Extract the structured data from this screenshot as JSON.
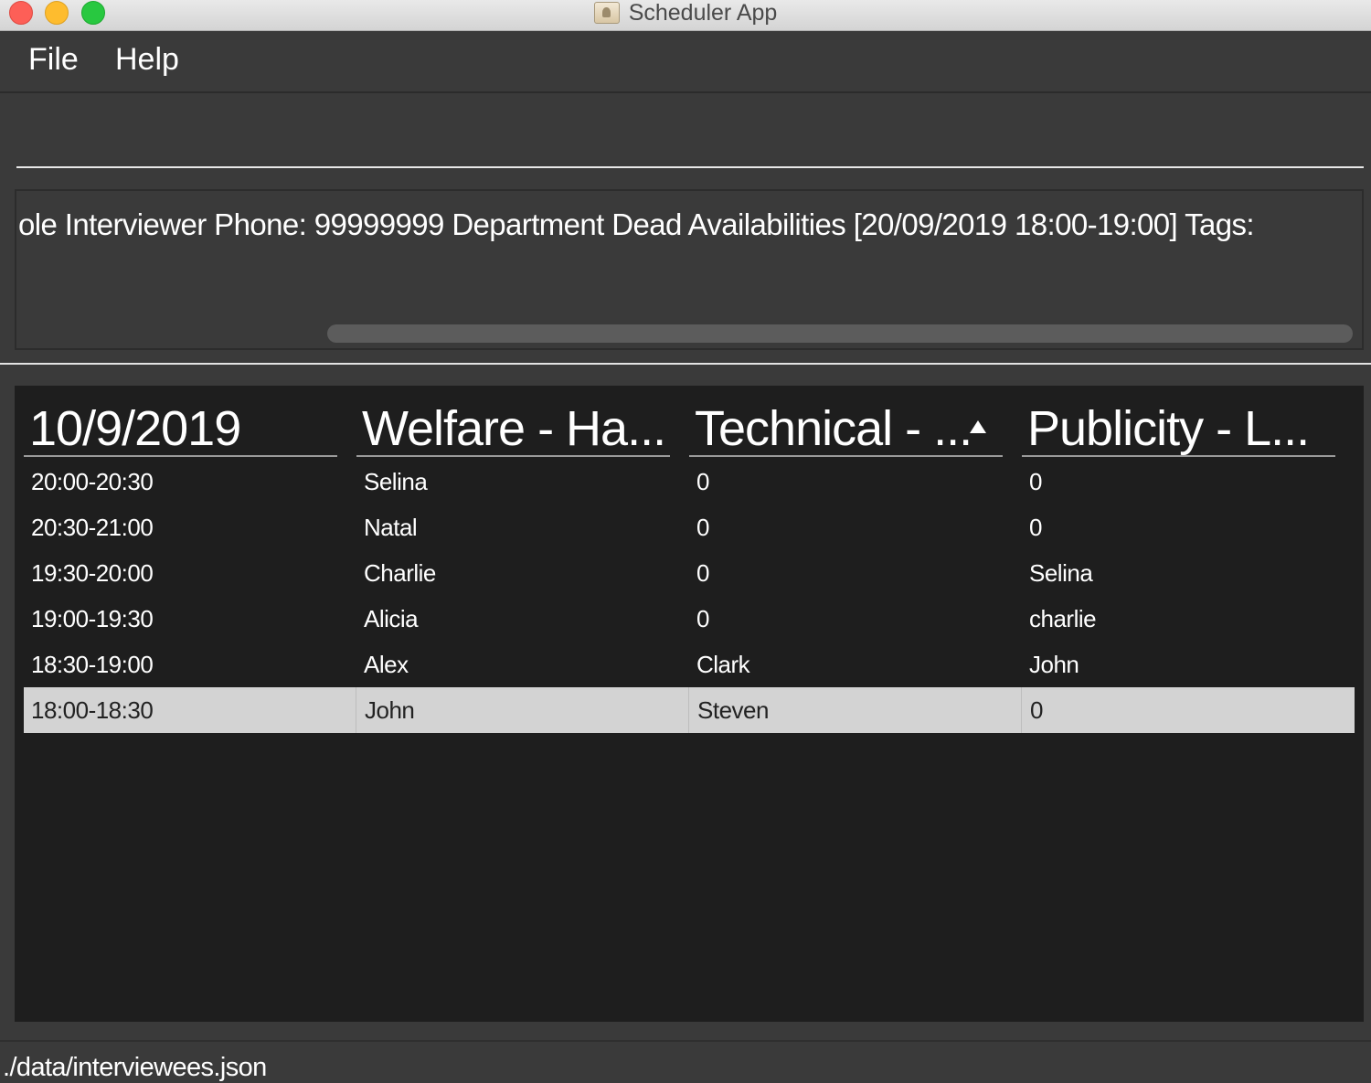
{
  "window": {
    "title": "Scheduler App",
    "app_icon": "contacts-app-icon"
  },
  "menu": {
    "items": [
      {
        "label": "File"
      },
      {
        "label": "Help"
      }
    ]
  },
  "command_box": {
    "value": "",
    "placeholder": ""
  },
  "result_display": {
    "text": "ole Interviewer Phone: 99999999 Department Dead Availabilities [20/09/2019 18:00-19:00] Tags:"
  },
  "schedule_table": {
    "headers": [
      "10/9/2019",
      "Welfare - Ha...",
      "Technical - ...",
      "Publicity - L..."
    ],
    "sorted_column": 2,
    "sort_direction": "ascending",
    "rows": [
      [
        "20:00-20:30",
        "Selina",
        "0",
        "0"
      ],
      [
        "20:30-21:00",
        "Natal",
        "0",
        "0"
      ],
      [
        "19:30-20:00",
        "Charlie",
        "0",
        "Selina"
      ],
      [
        "19:00-19:30",
        "Alicia",
        "0",
        "charlie"
      ],
      [
        "18:30-19:00",
        "Alex",
        "Clark",
        "John"
      ],
      [
        "18:00-18:30",
        "John",
        "Steven",
        "0"
      ]
    ],
    "selected_row": 5
  },
  "status_bar": {
    "path": "./data/interviewees.json"
  },
  "colors": {
    "background": "#3a3a3a",
    "table_background": "#1e1e1e",
    "selected_row": "#d3d3d3",
    "text": "#ffffff"
  }
}
